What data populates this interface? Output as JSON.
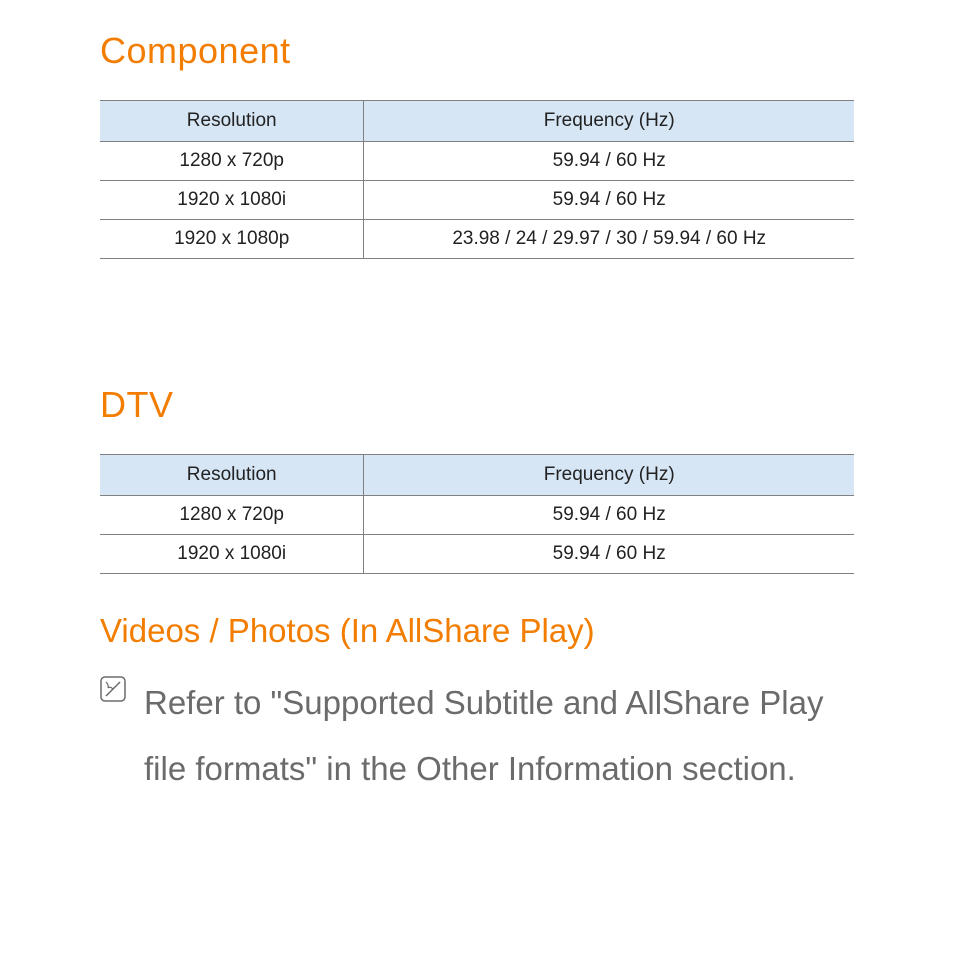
{
  "sections": {
    "component": {
      "title": "Component",
      "table": {
        "headers": [
          "Resolution",
          "Frequency (Hz)"
        ],
        "rows": [
          {
            "res": "1280 x 720p",
            "freq": "59.94 / 60 Hz"
          },
          {
            "res": "1920 x 1080i",
            "freq": "59.94 / 60 Hz"
          },
          {
            "res": "1920 x 1080p",
            "freq": "23.98 / 24 / 29.97 / 30 / 59.94 / 60 Hz"
          }
        ]
      }
    },
    "dtv": {
      "title": "DTV",
      "table": {
        "headers": [
          "Resolution",
          "Frequency (Hz)"
        ],
        "rows": [
          {
            "res": "1280 x 720p",
            "freq": "59.94 / 60 Hz"
          },
          {
            "res": "1920 x 1080i",
            "freq": "59.94 / 60 Hz"
          }
        ]
      }
    },
    "videos_photos": {
      "title": "Videos / Photos (In AllShare Play)",
      "note": "Refer to \"Supported Subtitle and AllShare Play file formats\" in the Other Information section."
    }
  }
}
